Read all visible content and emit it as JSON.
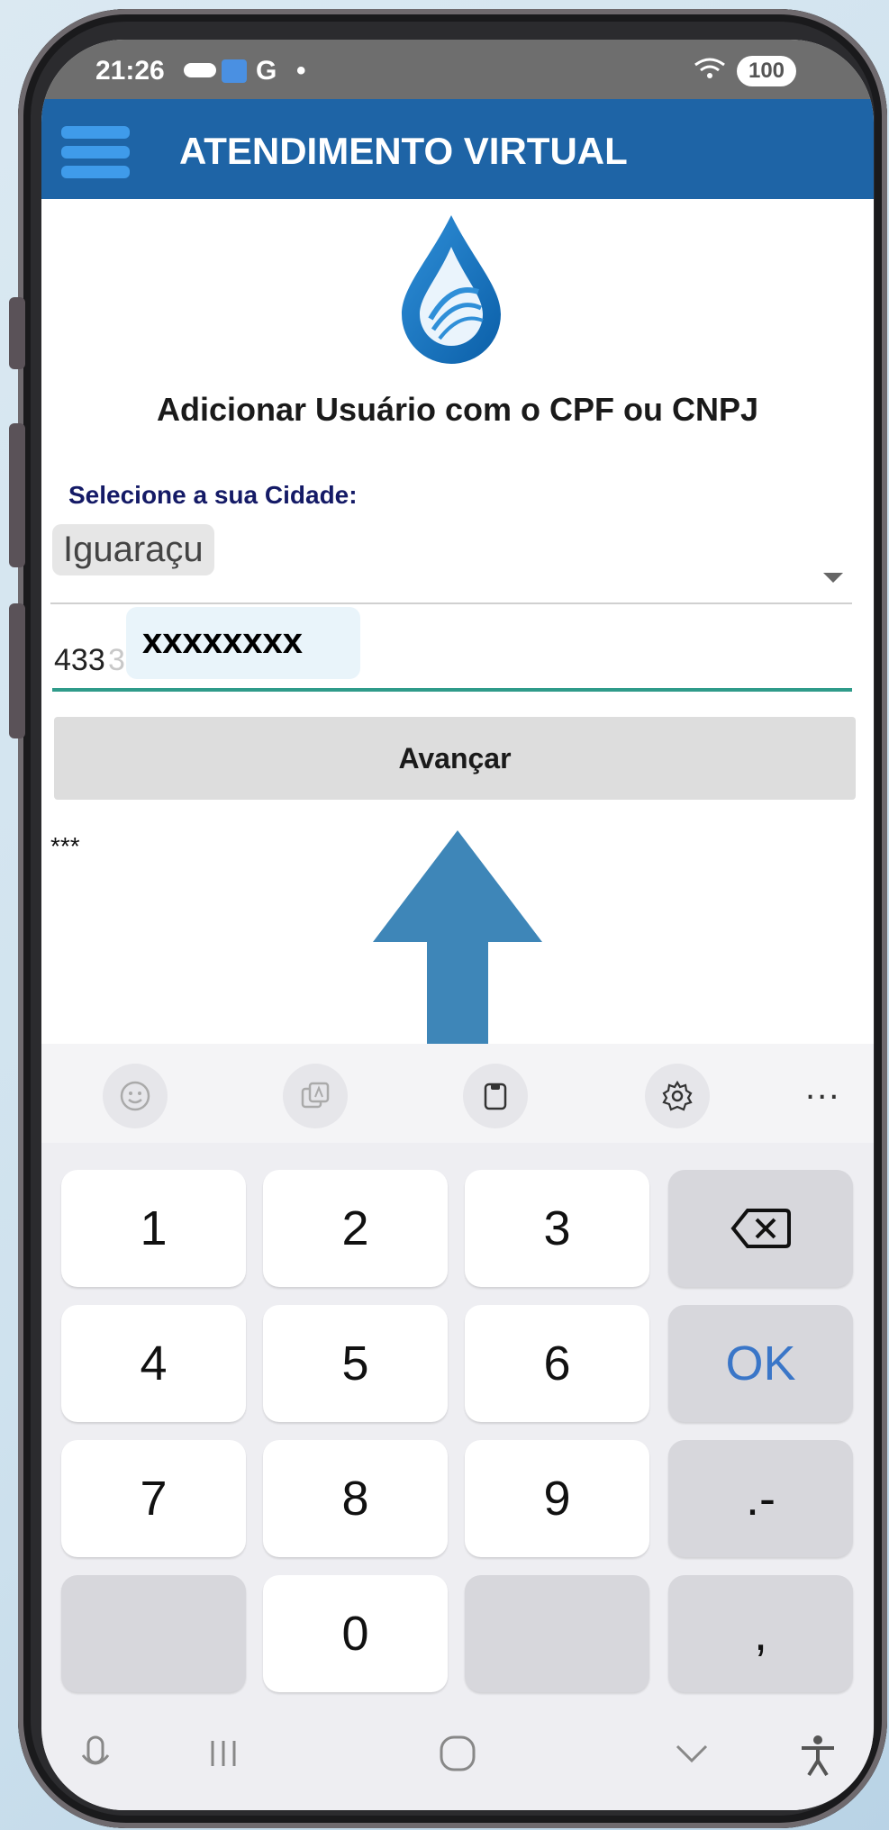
{
  "status_bar": {
    "time": "21:26",
    "g_label": "G",
    "dot": "•",
    "battery": "100"
  },
  "app_bar": {
    "title": "ATENDIMENTO VIRTUAL"
  },
  "form": {
    "heading": "Adicionar Usuário com o CPF ou CNPJ",
    "city_label": "Selecione a sua Cidade:",
    "city_value": "Iguaraçu",
    "cpf_prefix": "433",
    "cpf_ghost": "39115915",
    "cpf_mask": "xxxxxxxx",
    "submit_label": "Avançar",
    "note": "***"
  },
  "keyboard": {
    "more_label": "...",
    "rows": [
      [
        "1",
        "2",
        "3",
        "⌫"
      ],
      [
        "4",
        "5",
        "6",
        "OK"
      ],
      [
        "7",
        "8",
        "9",
        ".-"
      ],
      [
        "",
        "0",
        "",
        ","
      ]
    ]
  },
  "colors": {
    "app_bar": "#1e64a6",
    "arrow": "#3e86b8",
    "input_focus": "#2f9b8a"
  }
}
